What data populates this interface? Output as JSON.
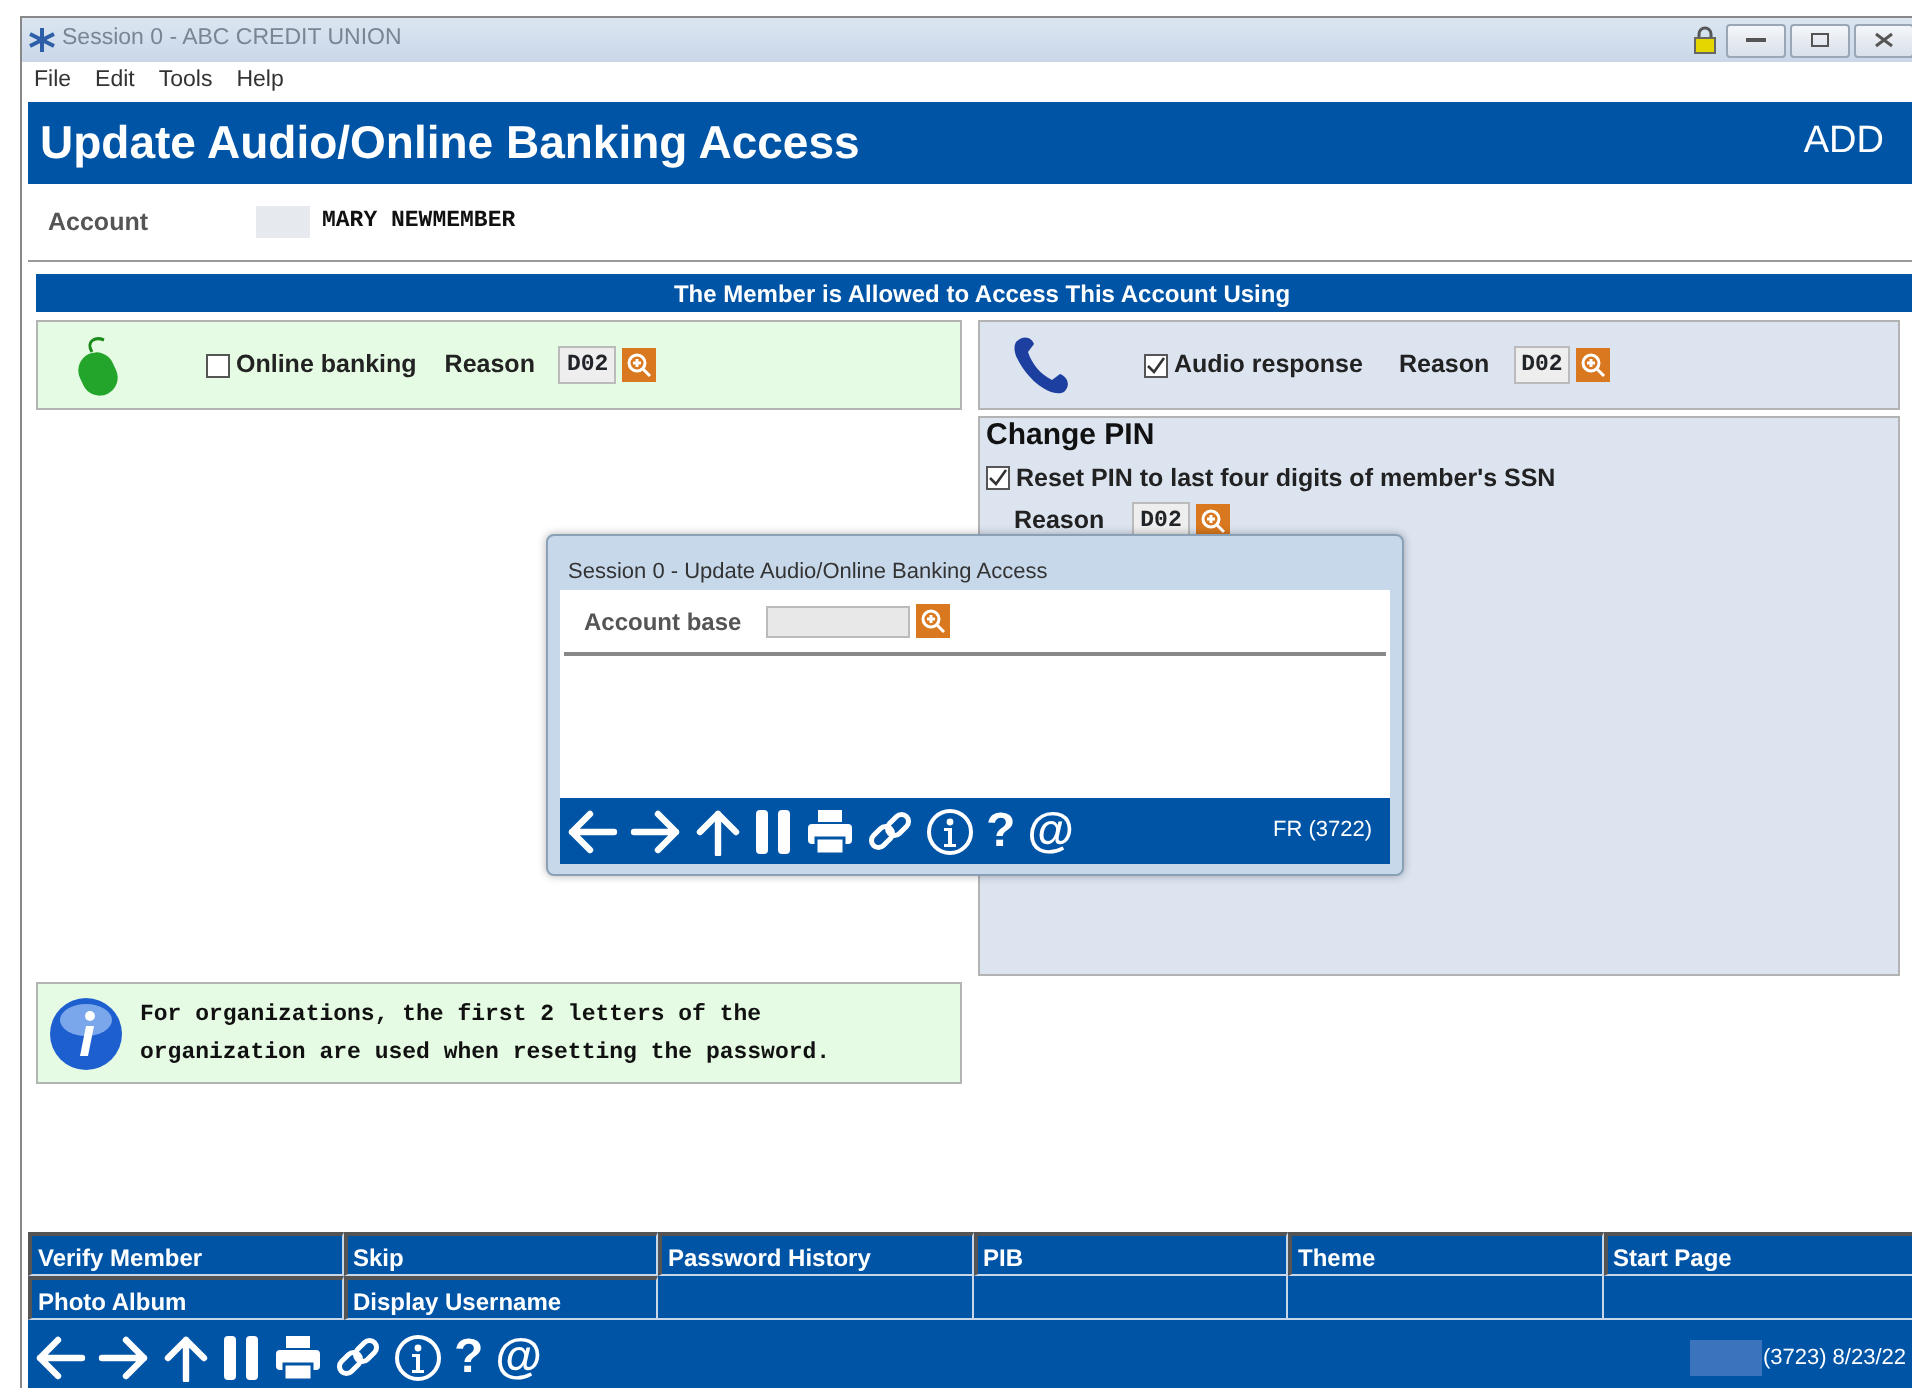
{
  "window": {
    "title": "Session 0  - ABC CREDIT UNION"
  },
  "menu": [
    "File",
    "Edit",
    "Tools",
    "Help"
  ],
  "header": {
    "title": "Update Audio/Online Banking Access",
    "mode": "ADD"
  },
  "account": {
    "label": "Account",
    "name": "MARY NEWMEMBER"
  },
  "band": "The Member is Allowed to Access This Account Using",
  "online": {
    "label": "Online banking",
    "checked": false,
    "reason_label": "Reason",
    "reason": "D02"
  },
  "audio": {
    "label": "Audio response",
    "checked": true,
    "reason_label": "Reason",
    "reason": "D02"
  },
  "change_pin": {
    "title": "Change PIN",
    "reset_label": "Reset PIN to last four digits of member's SSN",
    "checked": true,
    "reason_label": "Reason",
    "reason": "D02"
  },
  "info": {
    "lines": [
      "For organizations, the first 2 letters of the",
      "organization are used when resetting the password."
    ]
  },
  "function_keys": [
    "Verify Member",
    "Skip",
    "Password History",
    "PIB",
    "Theme",
    "Start Page",
    "Photo Album",
    "Display Username"
  ],
  "toolbar": [
    {
      "kind": "back"
    },
    {
      "kind": "forward"
    },
    {
      "kind": "up"
    },
    {
      "kind": "pause"
    },
    {
      "kind": "print"
    },
    {
      "kind": "link"
    },
    {
      "kind": "info"
    },
    {
      "kind": "help",
      "glyph": "?"
    },
    {
      "kind": "email",
      "glyph": "@"
    }
  ],
  "status": "(3723) 8/23/22",
  "dialog": {
    "title": "Session 0  - Update Audio/Online Banking Access",
    "field_label": "Account base",
    "status": "FR (3722)"
  }
}
